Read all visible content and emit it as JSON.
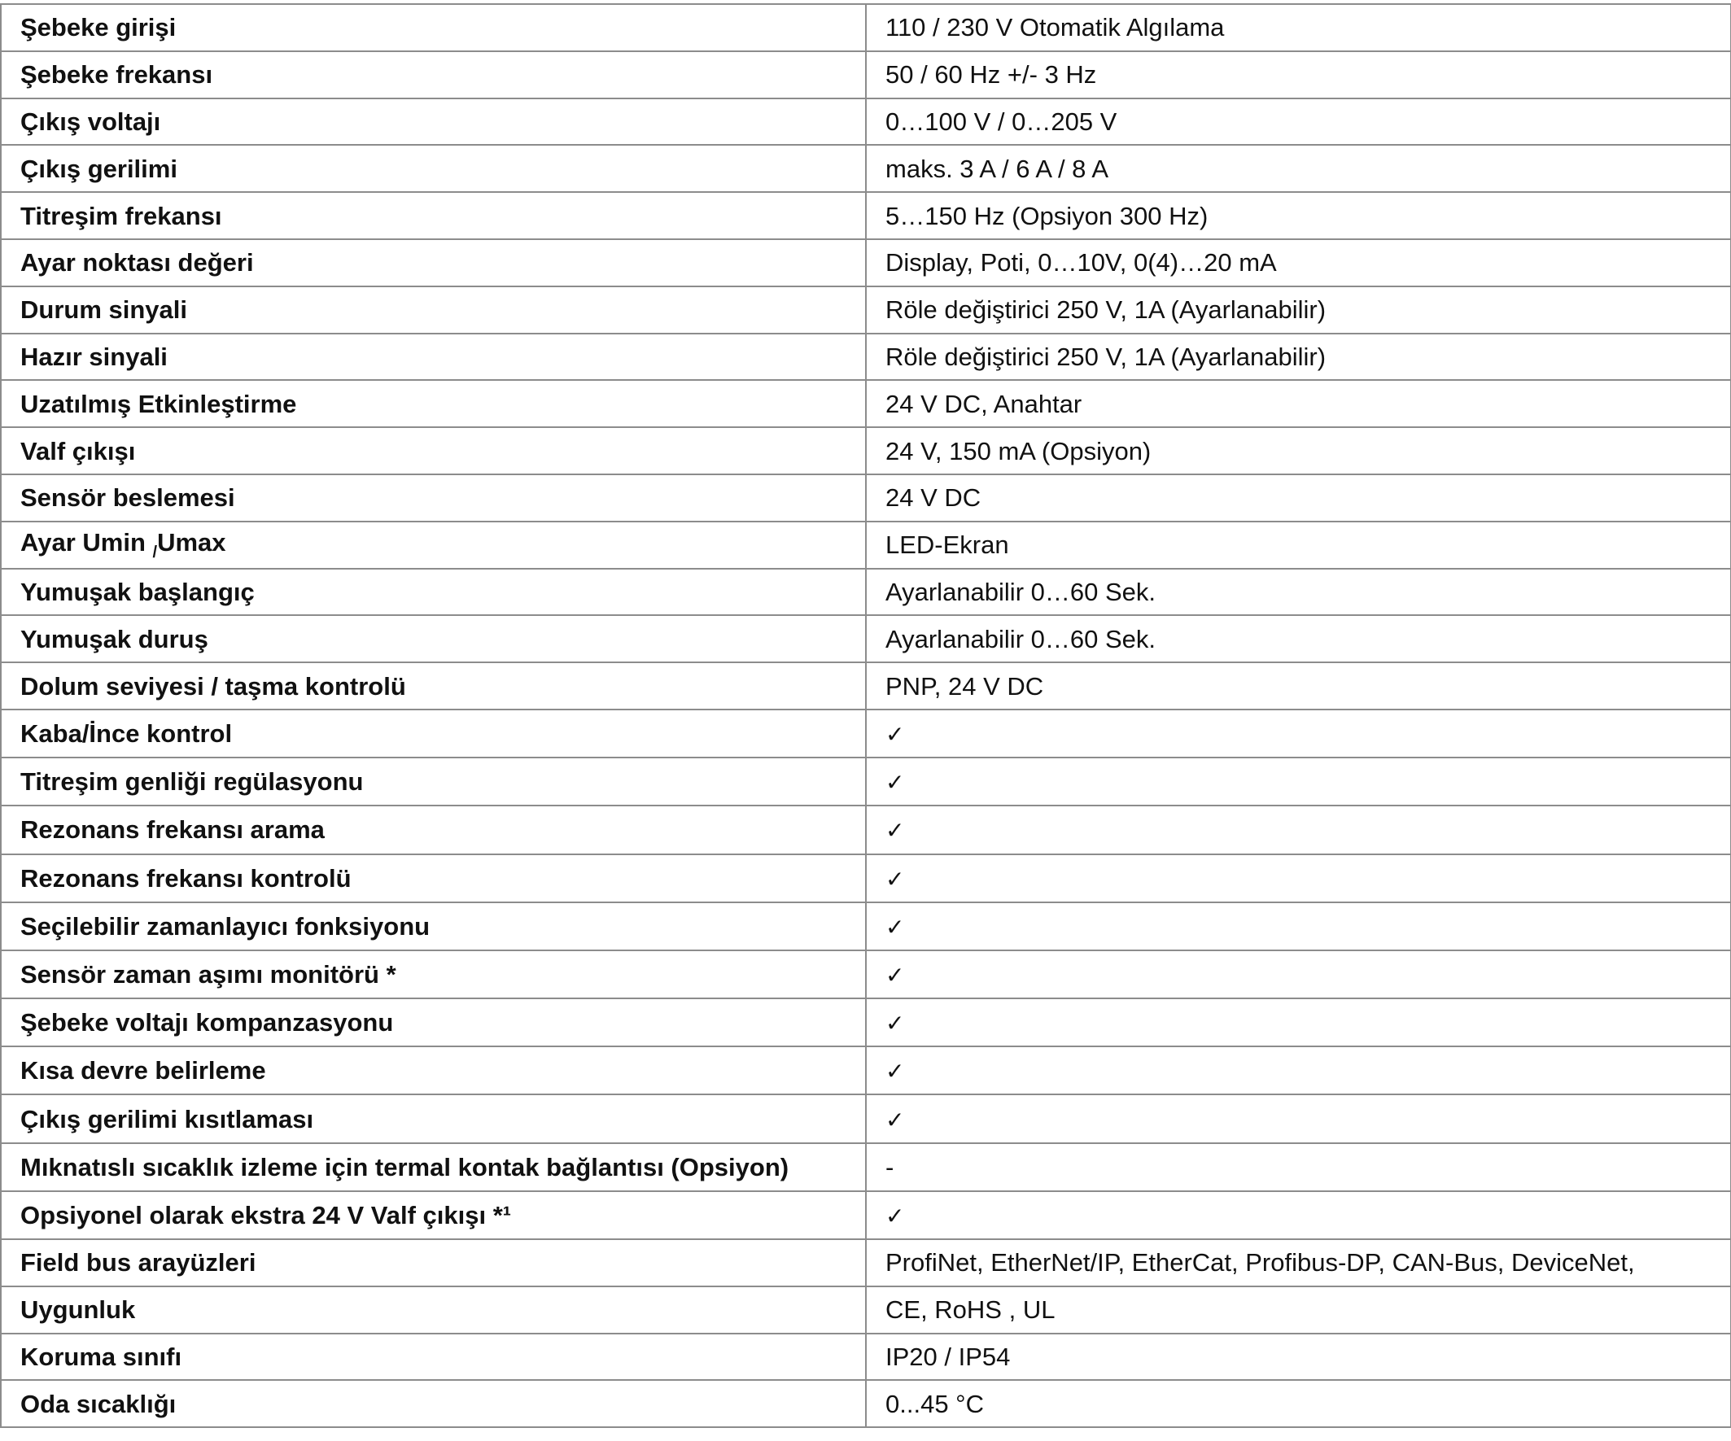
{
  "rows": [
    {
      "label": "Şebeke girişi",
      "value": "110 / 230 V Otomatik Algılama"
    },
    {
      "label": "Şebeke frekansı",
      "value": "50 / 60 Hz +/- 3 Hz"
    },
    {
      "label": "Çıkış voltajı",
      "value": "0…100 V / 0…205 V"
    },
    {
      "label": "Çıkış gerilimi",
      "value": "maks. 3 A / 6 A / 8 A"
    },
    {
      "label": "Titreşim frekansı",
      "value": "5…150 Hz (Opsiyon 300 Hz)"
    },
    {
      "label": "Ayar noktası değeri",
      "value": "Display, Poti, 0…10V, 0(4)…20 mA"
    },
    {
      "label": "Durum sinyali",
      "value": "Röle değiştirici 250 V, 1A (Ayarlanabilir)"
    },
    {
      "label": "Hazır sinyali",
      "value": "Röle değiştirici 250 V, 1A (Ayarlanabilir)"
    },
    {
      "label": "Uzatılmış Etkinleştirme",
      "value": "24 V DC, Anahtar"
    },
    {
      "label": "Valf çıkışı",
      "value": "24 V, 150 mA (Opsiyon)"
    },
    {
      "label": "Sensör beslemesi",
      "value": "24 V DC"
    },
    {
      "label_a": "Ayar Umin",
      "label_sep": "/",
      "label_b": "Umax",
      "value": "LED-Ekran"
    },
    {
      "label": "Yumuşak başlangıç",
      "value": "Ayarlanabilir 0…60 Sek."
    },
    {
      "label": "Yumuşak duruş",
      "value": "Ayarlanabilir 0…60 Sek."
    },
    {
      "label": "Dolum seviyesi / taşma kontrolü",
      "value": "PNP, 24 V DC"
    },
    {
      "label": "Kaba/İnce kontrol",
      "value": "✓"
    },
    {
      "label": "Titreşim genliği regülasyonu",
      "value": "✓"
    },
    {
      "label": "Rezonans frekansı arama",
      "value": "✓"
    },
    {
      "label": "Rezonans frekansı kontrolü",
      "value": "✓"
    },
    {
      "label": "Seçilebilir zamanlayıcı fonksiyonu",
      "value": "✓"
    },
    {
      "label": "Sensör zaman aşımı monitörü *",
      "value": "✓"
    },
    {
      "label": "Şebeke voltajı kompanzasyonu",
      "value": "✓"
    },
    {
      "label": "Kısa devre belirleme",
      "value": "✓"
    },
    {
      "label": "Çıkış gerilimi kısıtlaması",
      "value": "✓"
    },
    {
      "label": "Mıknatıslı sıcaklık izleme için termal kontak bağlantısı (Opsiyon)",
      "value": "-"
    },
    {
      "label": "Opsiyonel olarak ekstra 24 V Valf çıkışı *¹",
      "value": "✓"
    },
    {
      "label": "Field bus arayüzleri",
      "value": "ProfiNet, EtherNet/IP, EtherCat, Profibus-DP, CAN-Bus, DeviceNet,"
    },
    {
      "label": "Uygunluk",
      "value": "CE, RoHS , UL"
    },
    {
      "label": "Koruma sınıfı",
      "value": "IP20 / IP54"
    },
    {
      "label": "Oda sıcaklığı",
      "value": "0...45 °C"
    }
  ]
}
